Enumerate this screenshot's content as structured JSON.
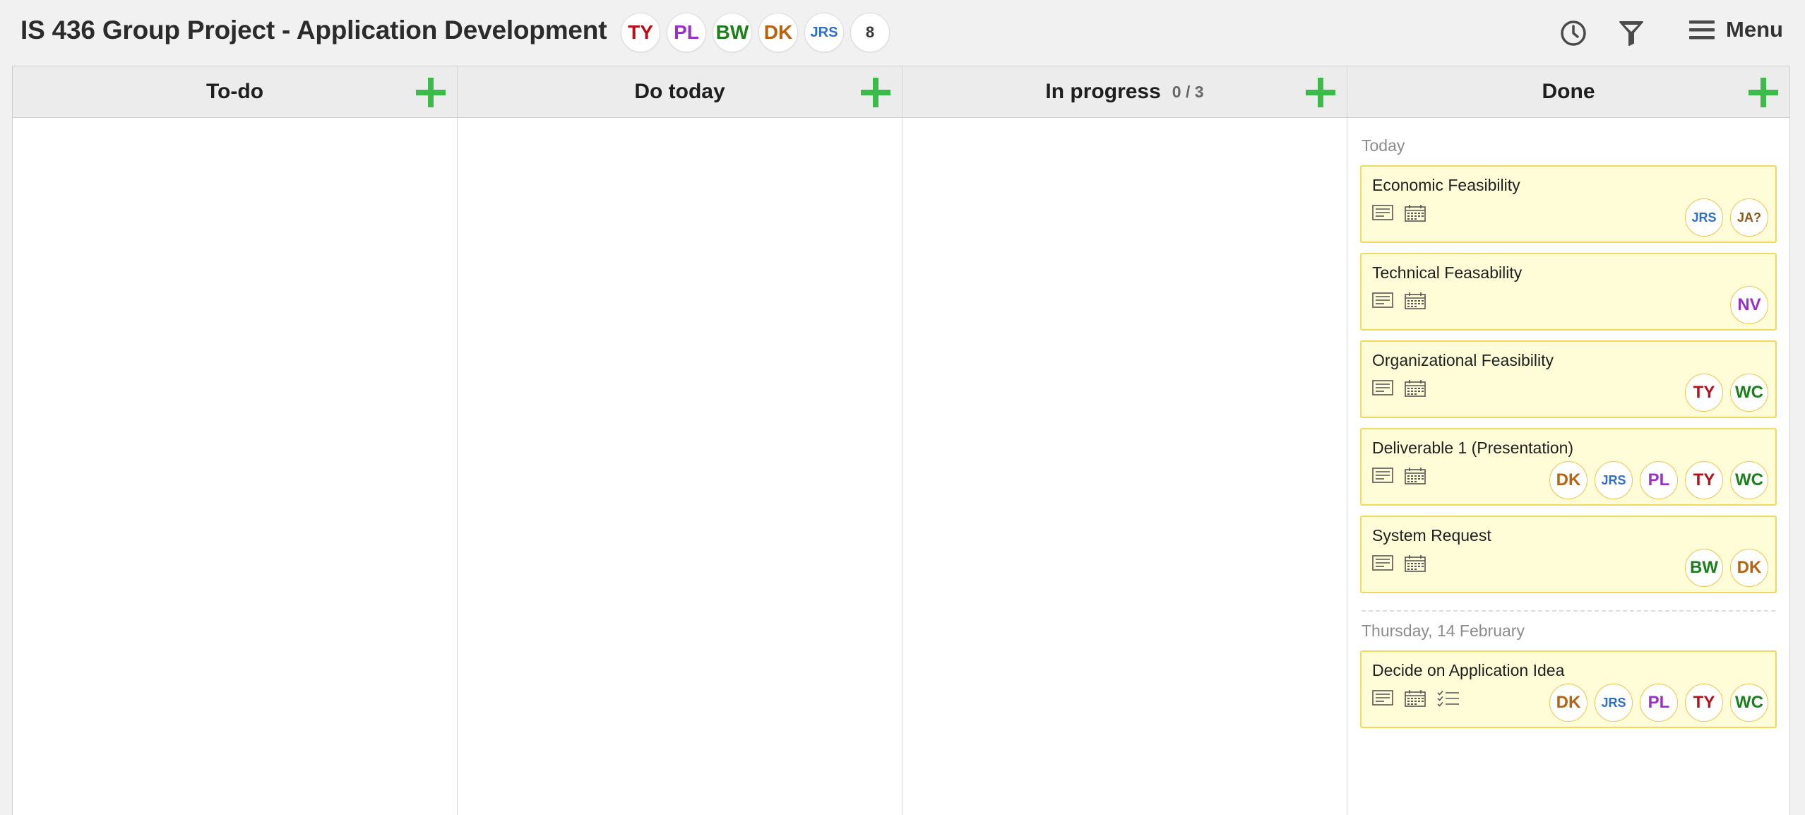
{
  "board": {
    "title": "IS 436 Group Project - Application Development",
    "members": [
      {
        "initials": "TY",
        "color": "#b8101a"
      },
      {
        "initials": "PL",
        "color": "#9b30c8"
      },
      {
        "initials": "BW",
        "color": "#1b7f1b"
      },
      {
        "initials": "DK",
        "color": "#b8620f"
      },
      {
        "initials": "JRS",
        "color": "#2f6fc9"
      }
    ],
    "more_members_count": "8"
  },
  "toolbar": {
    "history_icon": "clock-icon",
    "filter_icon": "filter-icon",
    "menu_icon": "hamburger-icon",
    "menu_label": "Menu"
  },
  "colors": {
    "accent_add": "#3cbb4a",
    "card_bg": "#fefdd8",
    "card_border": "#f0d95e"
  },
  "columns": {
    "todo": {
      "title": "To-do"
    },
    "today": {
      "title": "Do today"
    },
    "progress": {
      "title": "In progress",
      "wip": "0 / 3"
    },
    "done": {
      "title": "Done",
      "groups": [
        {
          "label": "Today",
          "cards": [
            {
              "title": "Economic Feasibility",
              "icons": [
                "description-icon",
                "calendar-icon"
              ],
              "assignees": [
                "JRS",
                "JA?"
              ]
            },
            {
              "title": "Technical Feasability",
              "icons": [
                "description-icon",
                "calendar-icon"
              ],
              "assignees": [
                "NV"
              ]
            },
            {
              "title": "Organizational Feasibility",
              "icons": [
                "description-icon",
                "calendar-icon"
              ],
              "assignees": [
                "TY",
                "WC"
              ]
            },
            {
              "title": "Deliverable 1 (Presentation)",
              "icons": [
                "description-icon",
                "calendar-icon"
              ],
              "assignees": [
                "DK",
                "JRS",
                "PL",
                "TY",
                "WC"
              ]
            },
            {
              "title": "System Request",
              "icons": [
                "description-icon",
                "calendar-icon"
              ],
              "assignees": [
                "BW",
                "DK"
              ]
            }
          ]
        },
        {
          "label": "Thursday, 14 February",
          "cards": [
            {
              "title": "Decide on Application Idea",
              "icons": [
                "description-icon",
                "calendar-icon",
                "checklist-icon"
              ],
              "assignees": [
                "DK",
                "JRS",
                "PL",
                "TY",
                "WC"
              ]
            }
          ]
        }
      ]
    }
  }
}
